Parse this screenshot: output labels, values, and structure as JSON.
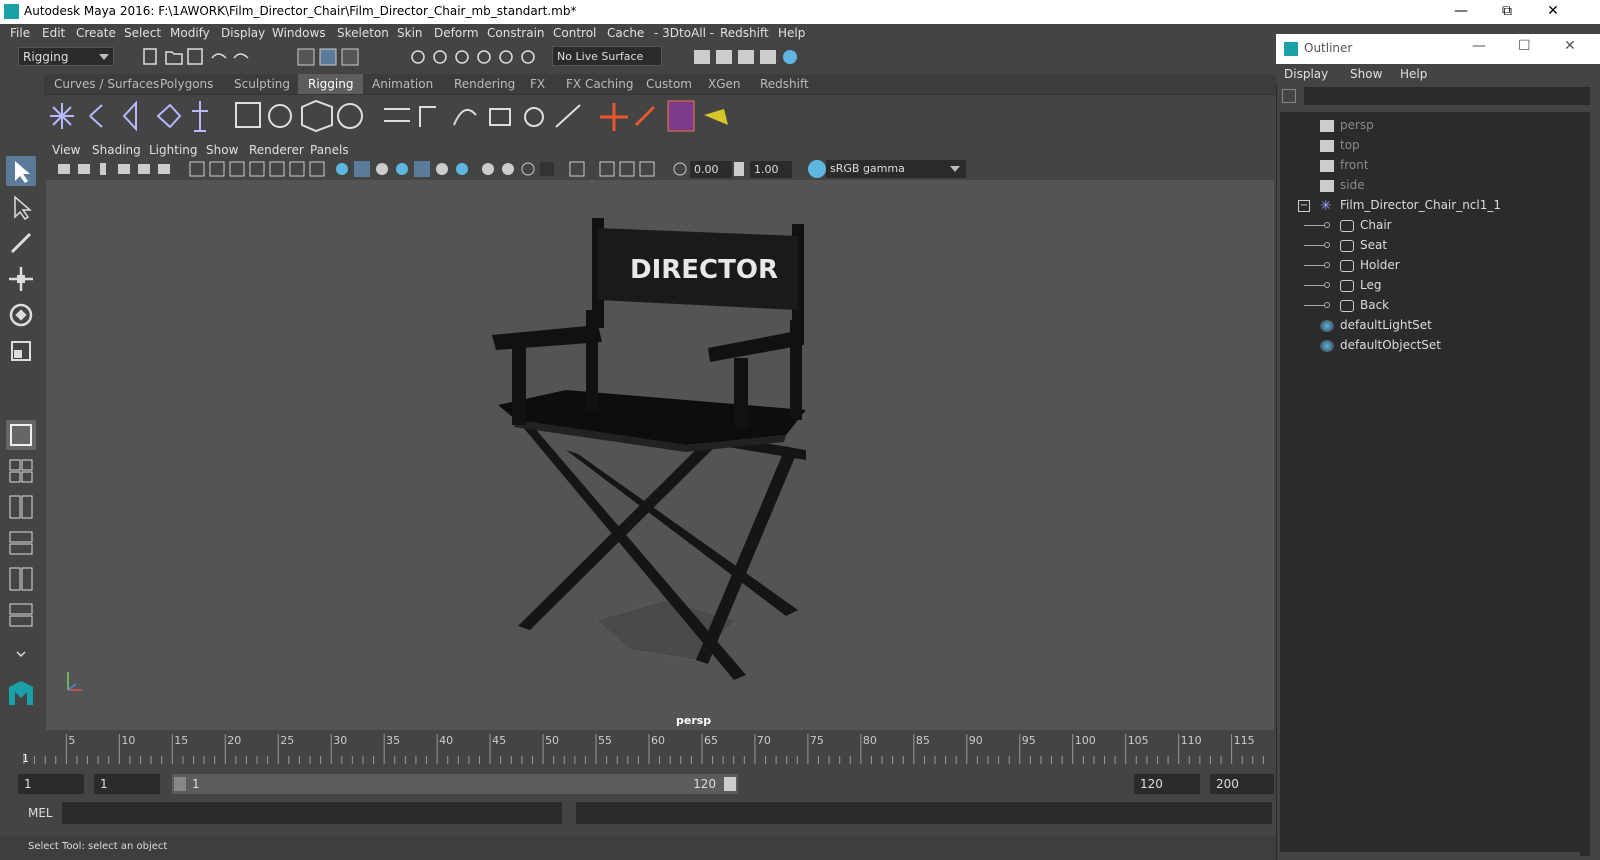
{
  "window": {
    "title": "Autodesk Maya 2016: F:\\1AWORK\\Film_Director_Chair\\Film_Director_Chair_mb_standart.mb*"
  },
  "menubar": [
    "File",
    "Edit",
    "Create",
    "Select",
    "Modify",
    "Display",
    "Windows",
    "Skeleton",
    "Skin",
    "Deform",
    "Constrain",
    "Control",
    "Cache",
    "- 3DtoAll -",
    "Redshift",
    "Help"
  ],
  "status_line": {
    "mode": "Rigging",
    "live_surface": "No Live Surface"
  },
  "shelf_tabs": [
    "Curves / Surfaces",
    "Polygons",
    "Sculpting",
    "Rigging",
    "Animation",
    "Rendering",
    "FX",
    "FX Caching",
    "Custom",
    "XGen",
    "Redshift"
  ],
  "active_shelf_tab": "Rigging",
  "panel_menu": [
    "View",
    "Shading",
    "Lighting",
    "Show",
    "Renderer",
    "Panels"
  ],
  "panel_toolbar": {
    "exposure": "0.00",
    "gamma_value": "1.00",
    "color_space": "sRGB gamma"
  },
  "viewport": {
    "camera_label": "persp",
    "chair_text": "DIRECTOR"
  },
  "timeline": {
    "ticks": [
      "5",
      "10",
      "15",
      "20",
      "25",
      "30",
      "35",
      "40",
      "45",
      "50",
      "55",
      "60",
      "65",
      "70",
      "75",
      "80",
      "85",
      "90",
      "95",
      "100",
      "105",
      "110",
      "115"
    ],
    "current_frame": "1"
  },
  "range": {
    "start_field": "1",
    "playback_start": "1",
    "slider_start": "1",
    "slider_end": "120",
    "playback_end": "120",
    "end_field": "200"
  },
  "command_line": {
    "label": "MEL"
  },
  "help_line": "Select Tool: select an object",
  "outliner": {
    "title": "Outliner",
    "menu": [
      "Display",
      "Show",
      "Help"
    ],
    "items": [
      {
        "label": "persp",
        "dim": true,
        "indent": 0,
        "icon": "camera-icon"
      },
      {
        "label": "top",
        "dim": true,
        "indent": 0,
        "icon": "camera-icon"
      },
      {
        "label": "front",
        "dim": true,
        "indent": 0,
        "icon": "camera-icon"
      },
      {
        "label": "side",
        "dim": true,
        "indent": 0,
        "icon": "camera-icon"
      },
      {
        "label": "Film_Director_Chair_ncl1_1",
        "dim": false,
        "indent": 0,
        "icon": "group-icon"
      },
      {
        "label": "Chair",
        "dim": false,
        "indent": 1,
        "icon": "mesh-icon"
      },
      {
        "label": "Seat",
        "dim": false,
        "indent": 1,
        "icon": "mesh-icon"
      },
      {
        "label": "Holder",
        "dim": false,
        "indent": 1,
        "icon": "mesh-icon"
      },
      {
        "label": "Leg",
        "dim": false,
        "indent": 1,
        "icon": "mesh-icon"
      },
      {
        "label": "Back",
        "dim": false,
        "indent": 1,
        "icon": "mesh-icon"
      },
      {
        "label": "defaultLightSet",
        "dim": false,
        "indent": 0,
        "icon": "set-icon"
      },
      {
        "label": "defaultObjectSet",
        "dim": false,
        "indent": 0,
        "icon": "set-icon"
      }
    ]
  },
  "colors": {
    "accent": "#5db7e0",
    "active_tab": "#5d5d5d",
    "panel_bg": "#444444",
    "viewport_bg": "#545454"
  }
}
